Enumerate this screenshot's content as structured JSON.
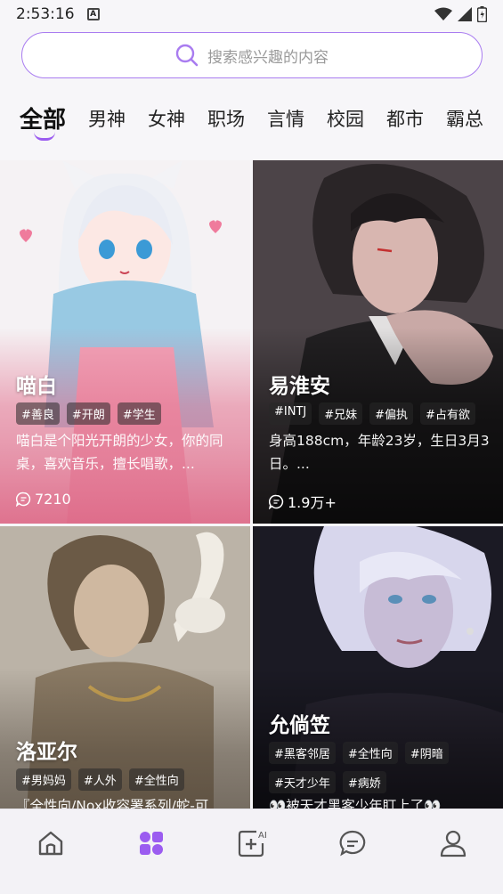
{
  "status": {
    "time": "2:53:16",
    "notif_letter": "A"
  },
  "search": {
    "placeholder": "搜索感兴趣的内容"
  },
  "tabs": [
    {
      "label": "全部",
      "active": true
    },
    {
      "label": "男神"
    },
    {
      "label": "女神"
    },
    {
      "label": "职场"
    },
    {
      "label": "言情"
    },
    {
      "label": "校园"
    },
    {
      "label": "都市"
    },
    {
      "label": "霸总"
    }
  ],
  "cards": [
    {
      "name": "喵白",
      "tags": [
        "#善良",
        "#开朗",
        "#学生"
      ],
      "desc": "喵白是个阳光开朗的少女，你的同桌，喜欢音乐，擅长唱歌，...",
      "count": "7210"
    },
    {
      "name": "易淮安",
      "tags": [
        "#INTJ",
        "#兄妹",
        "#偏执",
        "#占有欲"
      ],
      "desc": "身高188cm，年龄23岁，生日3月3日。...",
      "count": "1.9万+"
    },
    {
      "name": "洛亚尔",
      "tags": [
        "#男妈妈",
        "#人外",
        "#全性向"
      ],
      "desc": "『全性向/Nox收容署系列/蛇-可",
      "count": ""
    },
    {
      "name": "允倘笠",
      "tags": [
        "#黑客邻居",
        "#全性向",
        "#阴暗",
        "#天才少年",
        "#病娇"
      ],
      "desc": "👀被天才黑客少年盯上了👀",
      "count": ""
    }
  ],
  "colors": {
    "accent": "#9b5cf0",
    "search_border": "#a97cf0"
  },
  "nav": [
    "home-icon",
    "discover-icon",
    "ai-create-icon",
    "messages-icon",
    "profile-icon"
  ]
}
